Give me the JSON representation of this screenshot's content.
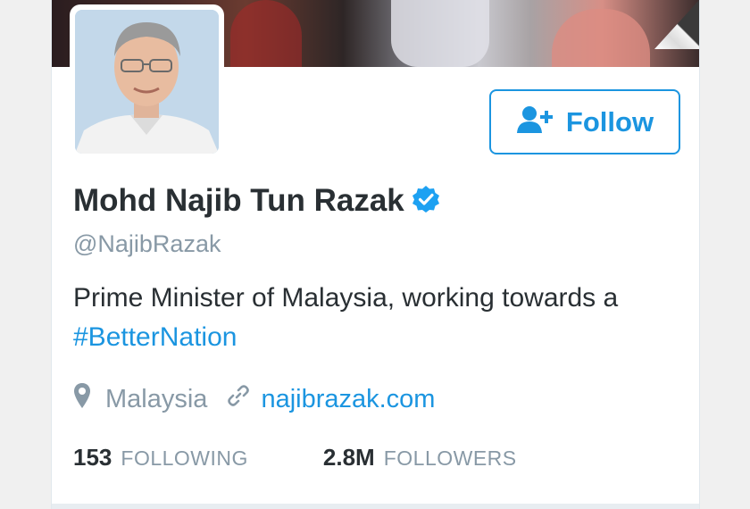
{
  "profile": {
    "name": "Mohd Najib Tun Razak",
    "verified": true,
    "handle": "@NajibRazak",
    "bio_text": "Prime Minister of Malaysia, working towards a",
    "bio_hashtag": "#BetterNation",
    "location": "Malaysia",
    "website": "najibrazak.com"
  },
  "actions": {
    "follow_label": "Follow"
  },
  "stats": {
    "following_count": "153",
    "following_label": "FOLLOWING",
    "followers_count": "2.8M",
    "followers_label": "FOLLOWERS"
  },
  "icons": {
    "follow": "add-user-icon",
    "verified": "verified-badge-icon",
    "location": "location-pin-icon",
    "link": "link-icon"
  },
  "colors": {
    "accent": "#1b95e0",
    "text_primary": "#292f33",
    "text_secondary": "#8899a6",
    "verified": "#1da1f2"
  }
}
